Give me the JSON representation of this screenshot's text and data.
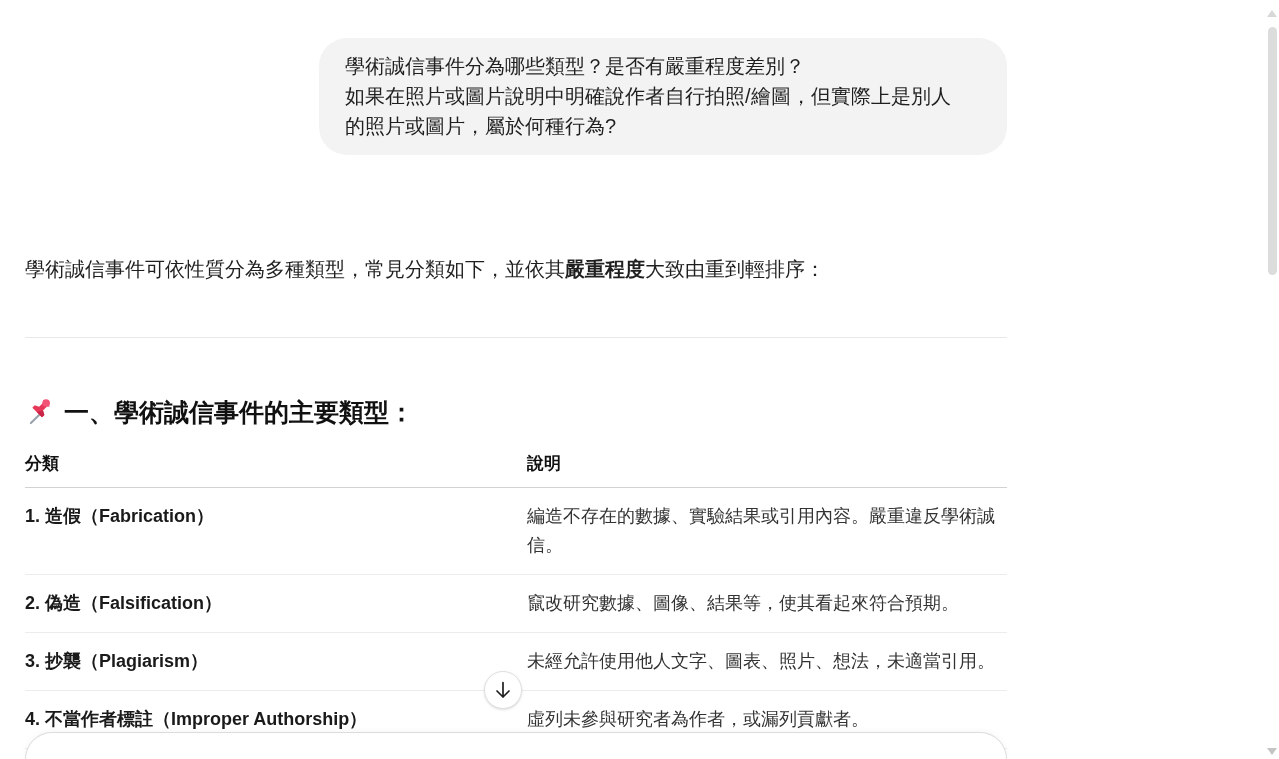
{
  "user_message": {
    "paragraphs": [
      "學術誠信事件分為哪些類型？是否有嚴重程度差別？",
      "如果在照片或圖片說明中明確說作者自行拍照/繪圖，但實際上是別人的照片或圖片，屬於何種行為?"
    ]
  },
  "response": {
    "intro": "學術誠信事件可依性質分為多種類型，常見分類如下，並依其**嚴重程度**大致由重到輕排序：",
    "heading": "一、學術誠信事件的主要類型：",
    "table": {
      "columns": [
        "分類",
        "說明"
      ],
      "rows": [
        {
          "category": "1. 造假（Fabrication）",
          "description": "編造不存在的數據、實驗結果或引用內容。嚴重違反學術誠信。"
        },
        {
          "category": "2. 偽造（Falsification）",
          "description": "竄改研究數據、圖像、結果等，使其看起來符合預期。"
        },
        {
          "category": "3. 抄襲（Plagiarism）",
          "description": "未經允許使用他人文字、圖表、照片、想法，未適當引用。"
        },
        {
          "category": "4. 不當作者標註（Improper Authorship）",
          "description": "虛列未參與研究者為作者，或漏列貢獻者。"
        }
      ]
    }
  }
}
